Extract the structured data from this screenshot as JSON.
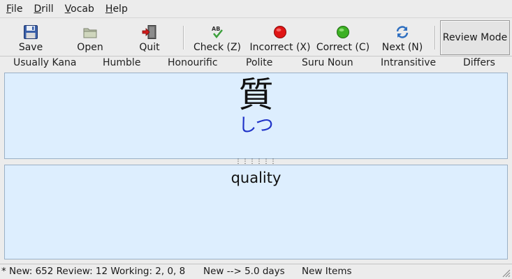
{
  "menu": [
    {
      "mnemonic": "F",
      "rest": "ile"
    },
    {
      "mnemonic": "D",
      "rest": "rill"
    },
    {
      "mnemonic": "V",
      "rest": "ocab"
    },
    {
      "mnemonic": "H",
      "rest": "elp"
    }
  ],
  "toolbar": {
    "save": {
      "label": "Save",
      "icon": "floppy-disk-icon"
    },
    "open": {
      "label": "Open",
      "icon": "folder-icon"
    },
    "quit": {
      "label": "Quit",
      "icon": "exit-door-icon"
    },
    "check": {
      "label": "Check (Z)",
      "icon": "spellcheck-icon"
    },
    "incorrect": {
      "label": "Incorrect (X)",
      "icon": "red-circle-icon",
      "color": "#e01515"
    },
    "correct": {
      "label": "Correct (C)",
      "icon": "green-circle-icon",
      "color": "#3cb023"
    },
    "next": {
      "label": "Next (N)",
      "icon": "refresh-arrows-icon"
    },
    "review_mode": "Review Mode"
  },
  "tags": [
    "Usually Kana",
    "Humble",
    "Honourific",
    "Polite",
    "Suru Noun",
    "Intransitive",
    "Differs"
  ],
  "card": {
    "kanji": "質",
    "reading": "しつ",
    "meaning": "quality",
    "reading_color": "#2033c8",
    "panel_bg": "#ddeefe"
  },
  "status": {
    "counts": "* New: 652 Review: 12 Working: 2, 0, 8",
    "interval": "New --> 5.0 days",
    "category": "New Items"
  }
}
